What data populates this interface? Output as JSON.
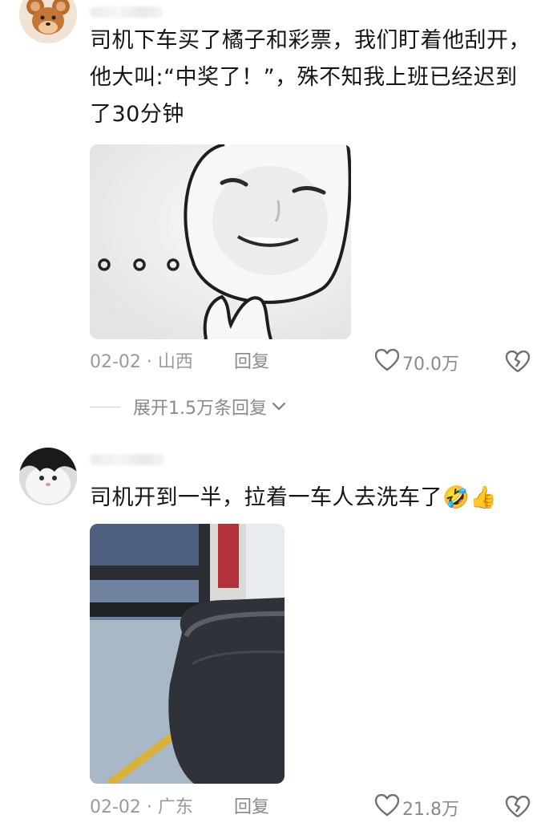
{
  "comments": [
    {
      "text": "司机下车买了橘子和彩票，我们盯着他刮开，他大叫:“中奖了！”，殊不知我上班已经迟到了30分钟",
      "date_location": "02-02 · 山西",
      "reply_label": "回复",
      "likes": "70.0万",
      "expand_label": "展开1.5万条回复"
    },
    {
      "text": "司机开到一半，拉着一车人去洗车了",
      "emoji": [
        "🤣",
        "👍"
      ],
      "date_location": "02-02 · 广东",
      "reply_label": "回复",
      "likes": "21.8万"
    }
  ]
}
